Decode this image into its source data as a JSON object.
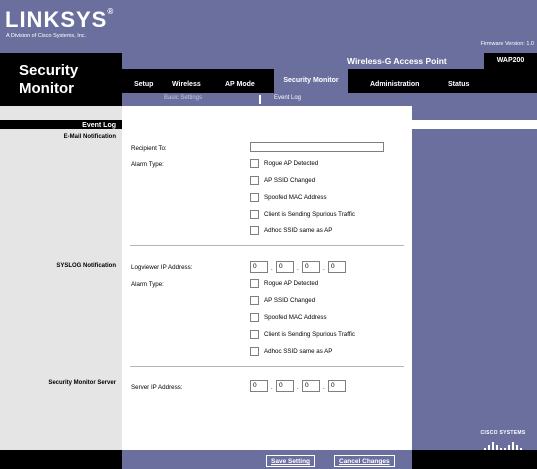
{
  "header": {
    "logo": "LINKSYS",
    "logo_reg": "®",
    "logo_sub": "A Division of Cisco Systems, Inc.",
    "firmware_version": "Firmware Version: 1.0"
  },
  "page_title": {
    "line1": "Security",
    "line2": "Monitor"
  },
  "product": {
    "name": "Wireless-G Access Point",
    "model": "WAP200"
  },
  "tabs": [
    {
      "label": "Setup"
    },
    {
      "label": "Wireless"
    },
    {
      "label": "AP Mode"
    },
    {
      "label": "Security Monitor"
    },
    {
      "label": "Administration"
    },
    {
      "label": "Status"
    }
  ],
  "subtabs": [
    {
      "label": "Basic Settings"
    },
    {
      "label": "Event Log"
    }
  ],
  "sidebar": {
    "section": "Event Log",
    "email_label": "E-Mail Notification",
    "syslog_label": "SYSLOG Notification",
    "server_label": "Security Monitor Server"
  },
  "email": {
    "recipient_label": "Recipient To:",
    "recipient_value": "",
    "alarm_label": "Alarm Type:",
    "alarms": [
      "Rogue AP Detected",
      "AP SSID Changed",
      "Spoofed MAC Address",
      "Client is Sending Spurious Traffic",
      "Adhoc SSID same as AP"
    ]
  },
  "syslog": {
    "viewer_label": "Logviewer IP Address:",
    "ip": [
      "0",
      "0",
      "0",
      "0"
    ],
    "alarm_label": "Alarm Type:",
    "alarms": [
      "Rogue AP Detected",
      "AP SSID Changed",
      "Spoofed MAC Address",
      "Client is Sending Spurious Traffic",
      "Adhoc SSID same as AP"
    ]
  },
  "server": {
    "ip_label": "Server IP Address:",
    "ip": [
      "0",
      "0",
      "0",
      "0"
    ]
  },
  "footer": {
    "save": "Save Setting",
    "cancel": "Cancel Changes"
  },
  "brand": {
    "cisco": "CISCO SYSTEMS"
  },
  "colors": {
    "accent": "#6b6f9e",
    "dark": "#000000",
    "sidebar": "#e5e5e5"
  }
}
